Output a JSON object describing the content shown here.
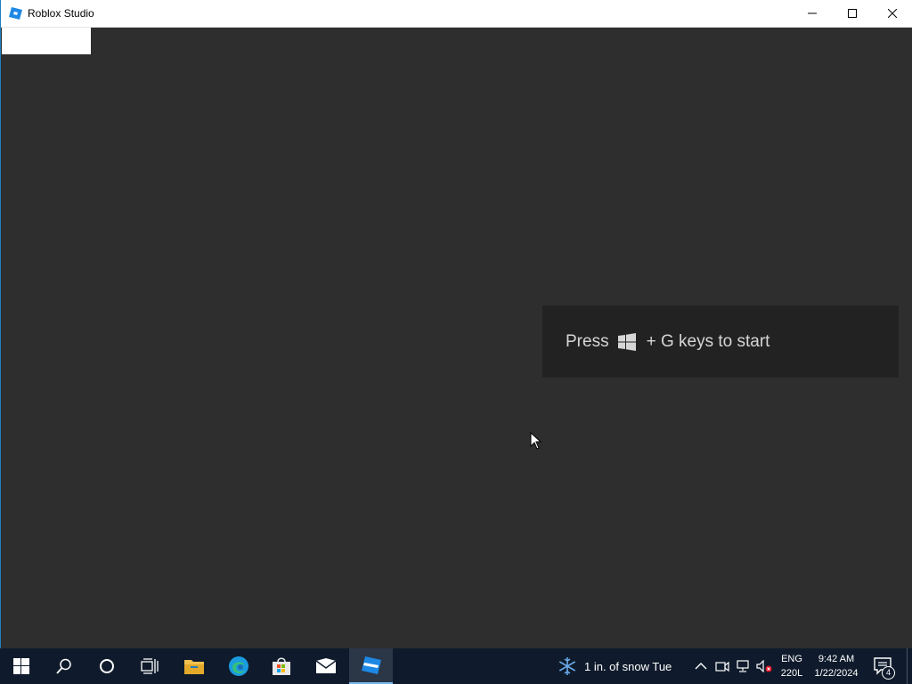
{
  "window": {
    "title": "Roblox Studio"
  },
  "toast": {
    "prefix": "Press",
    "suffix": "+ G keys to start"
  },
  "taskbar": {
    "weather_text": "1 in. of snow Tue",
    "language": {
      "line1": "ENG",
      "line2": "220L"
    },
    "clock": {
      "time": "9:42 AM",
      "date": "1/22/2024"
    },
    "notification_count": "4",
    "pinned_apps": [
      "start-icon",
      "search-icon",
      "cortana-icon",
      "task-view-icon",
      "file-explorer-icon",
      "edge-icon",
      "store-icon",
      "mail-icon",
      "roblox-studio-icon"
    ],
    "active_app": "roblox-studio-icon"
  },
  "colors": {
    "accent": "#1f7fbf",
    "taskbar_bg": "#0f1b2c",
    "window_bg": "#2e2e2e",
    "toast_bg": "#222222"
  }
}
